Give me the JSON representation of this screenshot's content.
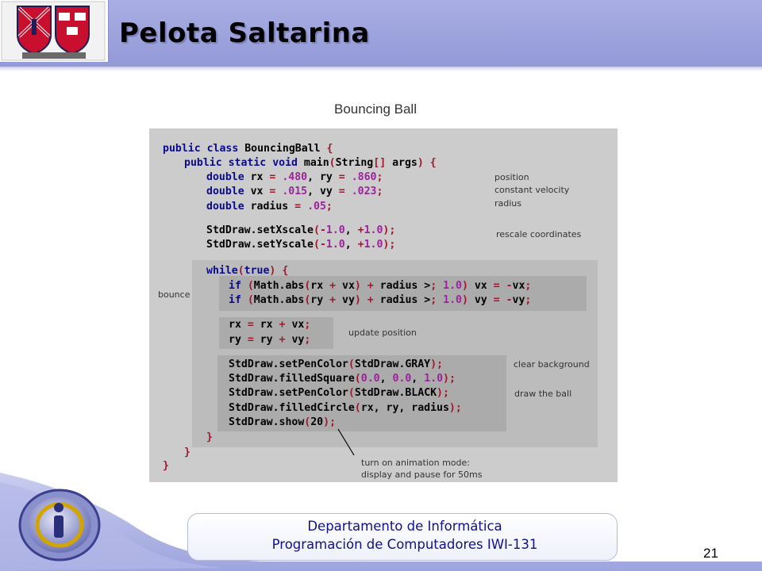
{
  "slide": {
    "title": "Pelota Saltarina",
    "figure_title": "Bouncing Ball",
    "page_number": "21"
  },
  "footer": {
    "line1": "Departamento de  Informática",
    "line2": "Programación de Computadores IWI-131"
  },
  "code": {
    "l1": "public class BouncingBall {",
    "l2": "public static void main(String[] args) {",
    "l3": "double rx = .480, ry = .860;",
    "l4": "double vx = .015, vy = .023;",
    "l5": "double radius = .05;",
    "l6": "StdDraw.setXscale(-1.0, +1.0);",
    "l7": "StdDraw.setYscale(-1.0, +1.0);",
    "l8": "while(true) {",
    "l9": "if (Math.abs(rx + vx) + radius > 1.0) vx = -vx;",
    "l10": "if (Math.abs(ry + vy) + radius > 1.0) vy = -vy;",
    "l11": "rx = rx + vx;",
    "l12": "ry = ry + vy;",
    "l13": "StdDraw.setPenColor(StdDraw.GRAY);",
    "l14": "StdDraw.filledSquare(0.0, 0.0, 1.0);",
    "l15": "StdDraw.setPenColor(StdDraw.BLACK);",
    "l16": "StdDraw.filledCircle(rx, ry, radius);",
    "l17": "StdDraw.show(20);",
    "l18": "}",
    "l19": "}",
    "l20": "}"
  },
  "annotations": {
    "position": "position",
    "velocity": "constant velocity",
    "radius": "radius",
    "rescale": "rescale coordinates",
    "bounce": "bounce",
    "update": "update position",
    "clear": "clear background",
    "draw": "draw the ball",
    "animation_1": "turn on animation mode:",
    "animation_2": "display and pause for 50ms"
  },
  "colors": {
    "header": "#9399d6",
    "footer_text": "#10108a",
    "keyword": "#0a0a8f",
    "number": "#9a239a"
  },
  "icons": {
    "logo": "university-crest-icon",
    "footer_logo": "department-logo-icon"
  }
}
